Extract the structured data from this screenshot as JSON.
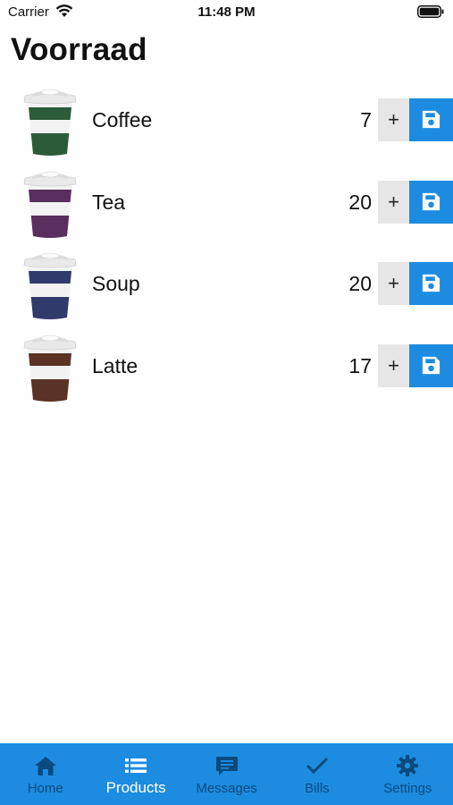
{
  "status_bar": {
    "carrier": "Carrier",
    "time": "11:48 PM"
  },
  "page": {
    "title": "Voorraad"
  },
  "products": [
    {
      "name": "Coffee",
      "quantity": "7",
      "cup_color": "#2c5b3a"
    },
    {
      "name": "Tea",
      "quantity": "20",
      "cup_color": "#5a2e5e"
    },
    {
      "name": "Soup",
      "quantity": "20",
      "cup_color": "#303a6b"
    },
    {
      "name": "Latte",
      "quantity": "17",
      "cup_color": "#5a3226"
    }
  ],
  "row_buttons": {
    "increment_label": "+",
    "save_icon": "floppy-disk-icon"
  },
  "tabbar": {
    "active": "Products",
    "tabs": [
      {
        "label": "Home",
        "icon": "home-icon"
      },
      {
        "label": "Products",
        "icon": "list-icon"
      },
      {
        "label": "Messages",
        "icon": "message-icon"
      },
      {
        "label": "Bills",
        "icon": "checkmark-icon"
      },
      {
        "label": "Settings",
        "icon": "gear-icon"
      }
    ]
  },
  "colors": {
    "accent": "#1d8ce0",
    "tab_inactive": "#0b4a7d",
    "plus_bg": "#e6e6e6"
  }
}
